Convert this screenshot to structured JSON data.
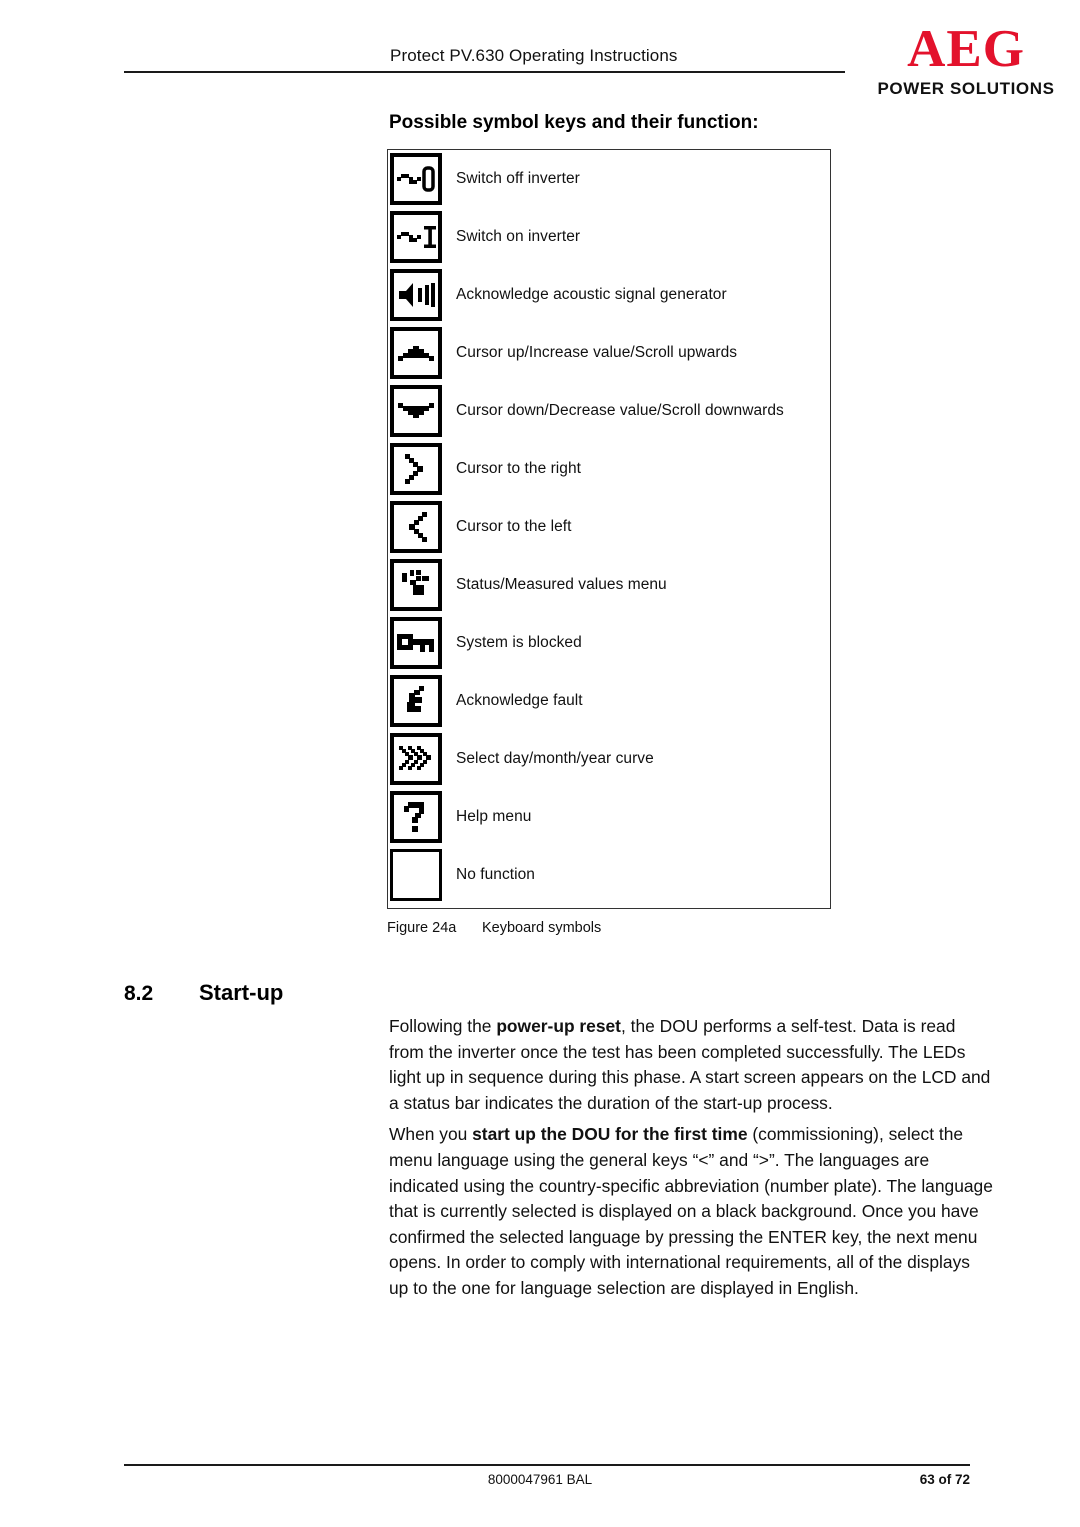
{
  "header": {
    "document_title": "Protect PV.630 Operating Instructions",
    "logo_primary": "AEG",
    "logo_secondary": "POWER SOLUTIONS",
    "logo_color": "#e3122c"
  },
  "symbols_section": {
    "heading": "Possible symbol keys and their function:",
    "rows": [
      {
        "icon": "switch-off-inverter-icon",
        "label": "Switch off inverter"
      },
      {
        "icon": "switch-on-inverter-icon",
        "label": "Switch on inverter"
      },
      {
        "icon": "speaker-acoustic-signal-icon",
        "label": "Acknowledge acoustic signal generator"
      },
      {
        "icon": "cursor-up-icon",
        "label": "Cursor up/Increase value/Scroll upwards"
      },
      {
        "icon": "cursor-down-icon",
        "label": "Cursor down/Decrease value/Scroll downwards"
      },
      {
        "icon": "cursor-right-icon",
        "label": "Cursor to the right"
      },
      {
        "icon": "cursor-left-icon",
        "label": "Cursor to the left"
      },
      {
        "icon": "status-measured-values-icon",
        "label": "Status/Measured values menu"
      },
      {
        "icon": "key-system-blocked-icon",
        "label": "System is blocked"
      },
      {
        "icon": "lightning-acknowledge-fault-icon",
        "label": "Acknowledge fault"
      },
      {
        "icon": "double-chevron-curve-icon",
        "label": "Select day/month/year curve"
      },
      {
        "icon": "question-mark-help-icon",
        "label": "Help menu"
      },
      {
        "icon": "blank-key-icon",
        "label": "No function"
      }
    ],
    "figure_caption_number": "Figure 24a",
    "figure_caption_text": "Keyboard symbols"
  },
  "startup_section": {
    "number": "8.2",
    "title": "Start-up",
    "paragraph1_part1": "Following the ",
    "paragraph1_bold": "power-up reset",
    "paragraph1_part2": ", the DOU performs a self-test. Data is read from the inverter once the test has been completed successfully. The LEDs light up in sequence during this phase. A start screen appears on the LCD and a status bar indicates the duration of the start-up process.",
    "paragraph2_part1": "When you ",
    "paragraph2_bold": "start up the DOU for the first time",
    "paragraph2_part2": " (commissioning), select the menu language using the general keys “<” and “>”. The languages are indicated using the country-specific abbreviation (number plate). The language that is currently selected is displayed on a black background. Once you have confirmed the selected language by pressing the ENTER key, the next menu opens. In order to comply with international requirements, all of the displays up to the one for language selection are displayed in English."
  },
  "footer": {
    "document_code": "8000047961 BAL",
    "page_label": "63 of 72"
  }
}
